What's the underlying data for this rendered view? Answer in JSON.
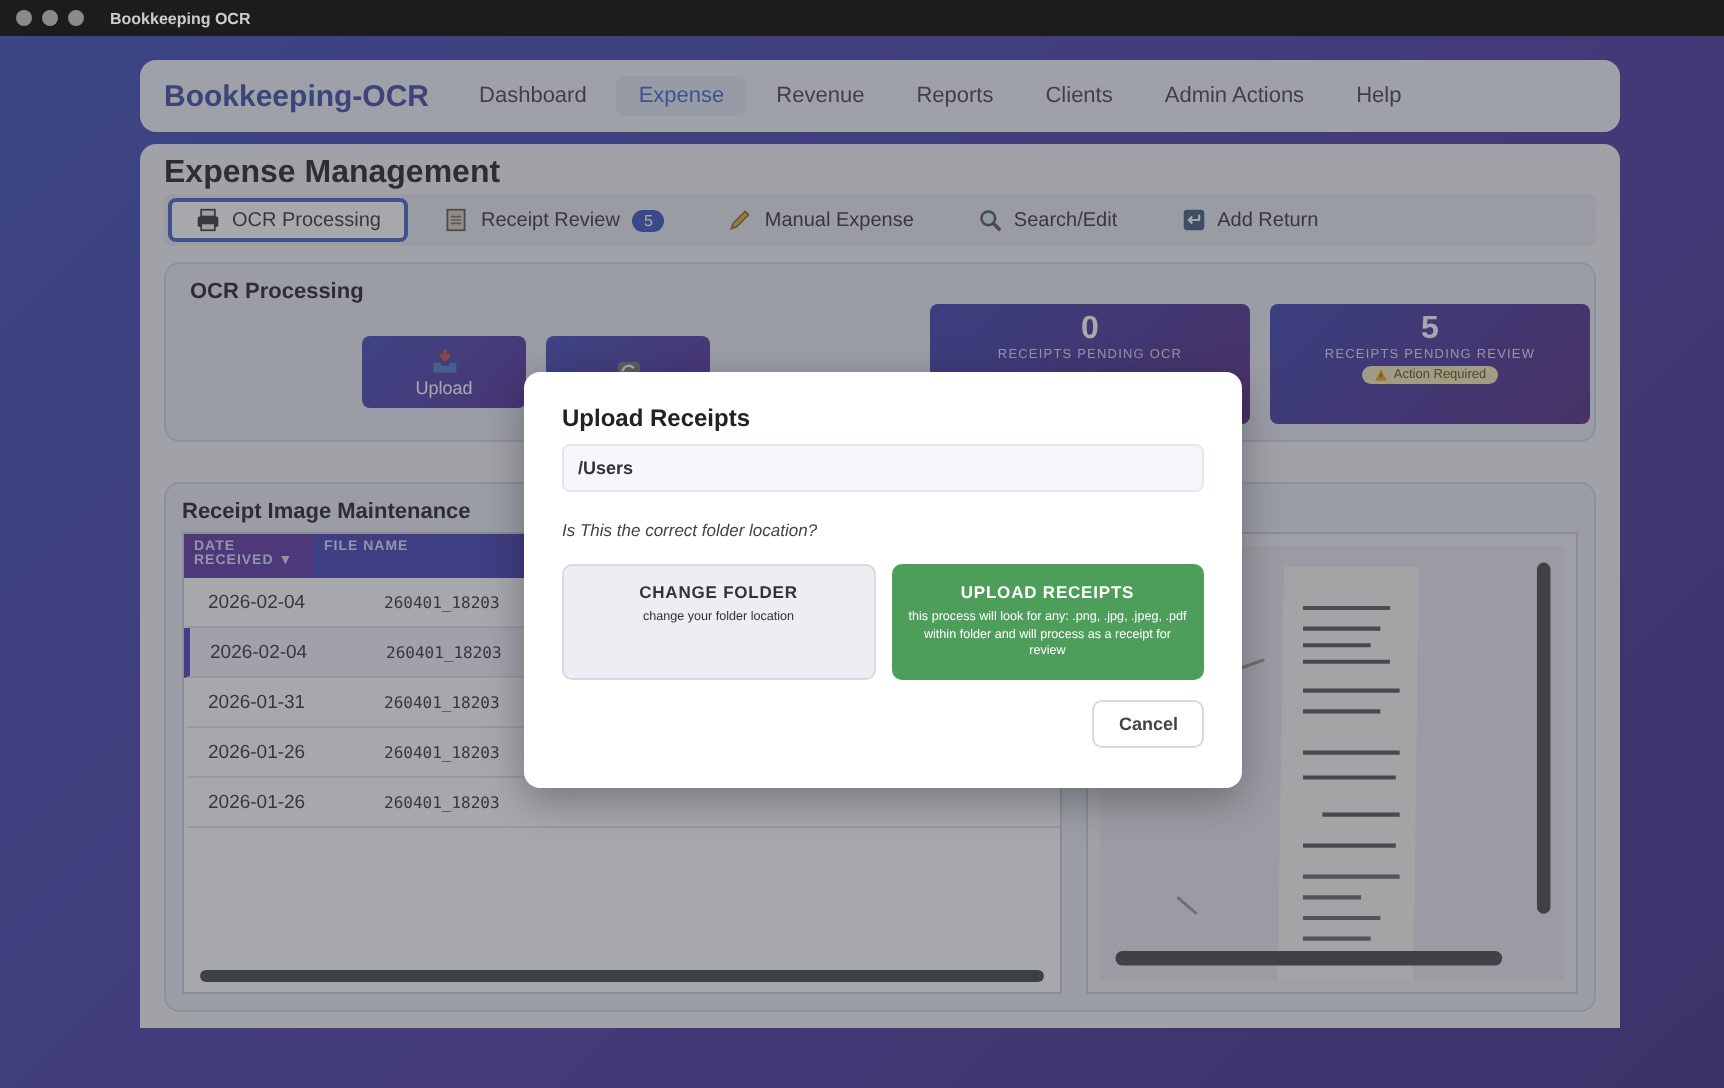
{
  "window": {
    "title": "Bookkeeping OCR"
  },
  "nav": {
    "brand": "Bookkeeping-OCR",
    "items": [
      {
        "label": "Dashboard",
        "selected": false
      },
      {
        "label": "Expense",
        "selected": true
      },
      {
        "label": "Revenue",
        "selected": false
      },
      {
        "label": "Reports",
        "selected": false
      },
      {
        "label": "Clients",
        "selected": false
      },
      {
        "label": "Admin Actions",
        "selected": false
      },
      {
        "label": "Help",
        "selected": false
      }
    ]
  },
  "page": {
    "title": "Expense Management"
  },
  "tabs": [
    {
      "label": "OCR Processing",
      "selected": true
    },
    {
      "label": "Receipt Review",
      "badge": "5",
      "selected": false
    },
    {
      "label": "Manual Expense",
      "selected": false
    },
    {
      "label": "Search/Edit",
      "selected": false
    },
    {
      "label": "Add Return",
      "selected": false
    }
  ],
  "ocr_panel": {
    "title": "OCR Processing",
    "actions": [
      {
        "kind": "labeled",
        "label": "Upload"
      },
      {
        "kind": "icon_only"
      }
    ],
    "stats": [
      {
        "value": "0",
        "label": "RECEIPTS PENDING OCR"
      },
      {
        "value": "5",
        "label": "RECEIPTS PENDING REVIEW",
        "badge": "Action Required"
      }
    ]
  },
  "maintenance": {
    "title": "Receipt Image Maintenance",
    "columns": [
      "DATE RECEIVED ▼",
      "FILE NAME"
    ],
    "rows": [
      {
        "date": "2026-02-04",
        "file": "260401_18203",
        "selected": false
      },
      {
        "date": "2026-02-04",
        "file": "260401_18203",
        "selected": true
      },
      {
        "date": "2026-01-31",
        "file": "260401_18203",
        "selected": false
      },
      {
        "date": "2026-01-26",
        "file": "260401_18203",
        "selected": false
      },
      {
        "date": "2026-01-26",
        "file": "260401_18203",
        "selected": false
      }
    ]
  },
  "modal": {
    "title": "Upload Receipts",
    "path": "/Users",
    "question": "Is This the correct folder location?",
    "options": [
      {
        "kind": "secondary",
        "title": "CHANGE FOLDER",
        "text": "change your folder location"
      },
      {
        "kind": "primary",
        "title": "UPLOAD RECEIPTS",
        "text": "this process will look for any: .png, .jpg, .jpeg, .pdf within folder and will process as a receipt for review"
      }
    ],
    "cancel": "Cancel"
  }
}
